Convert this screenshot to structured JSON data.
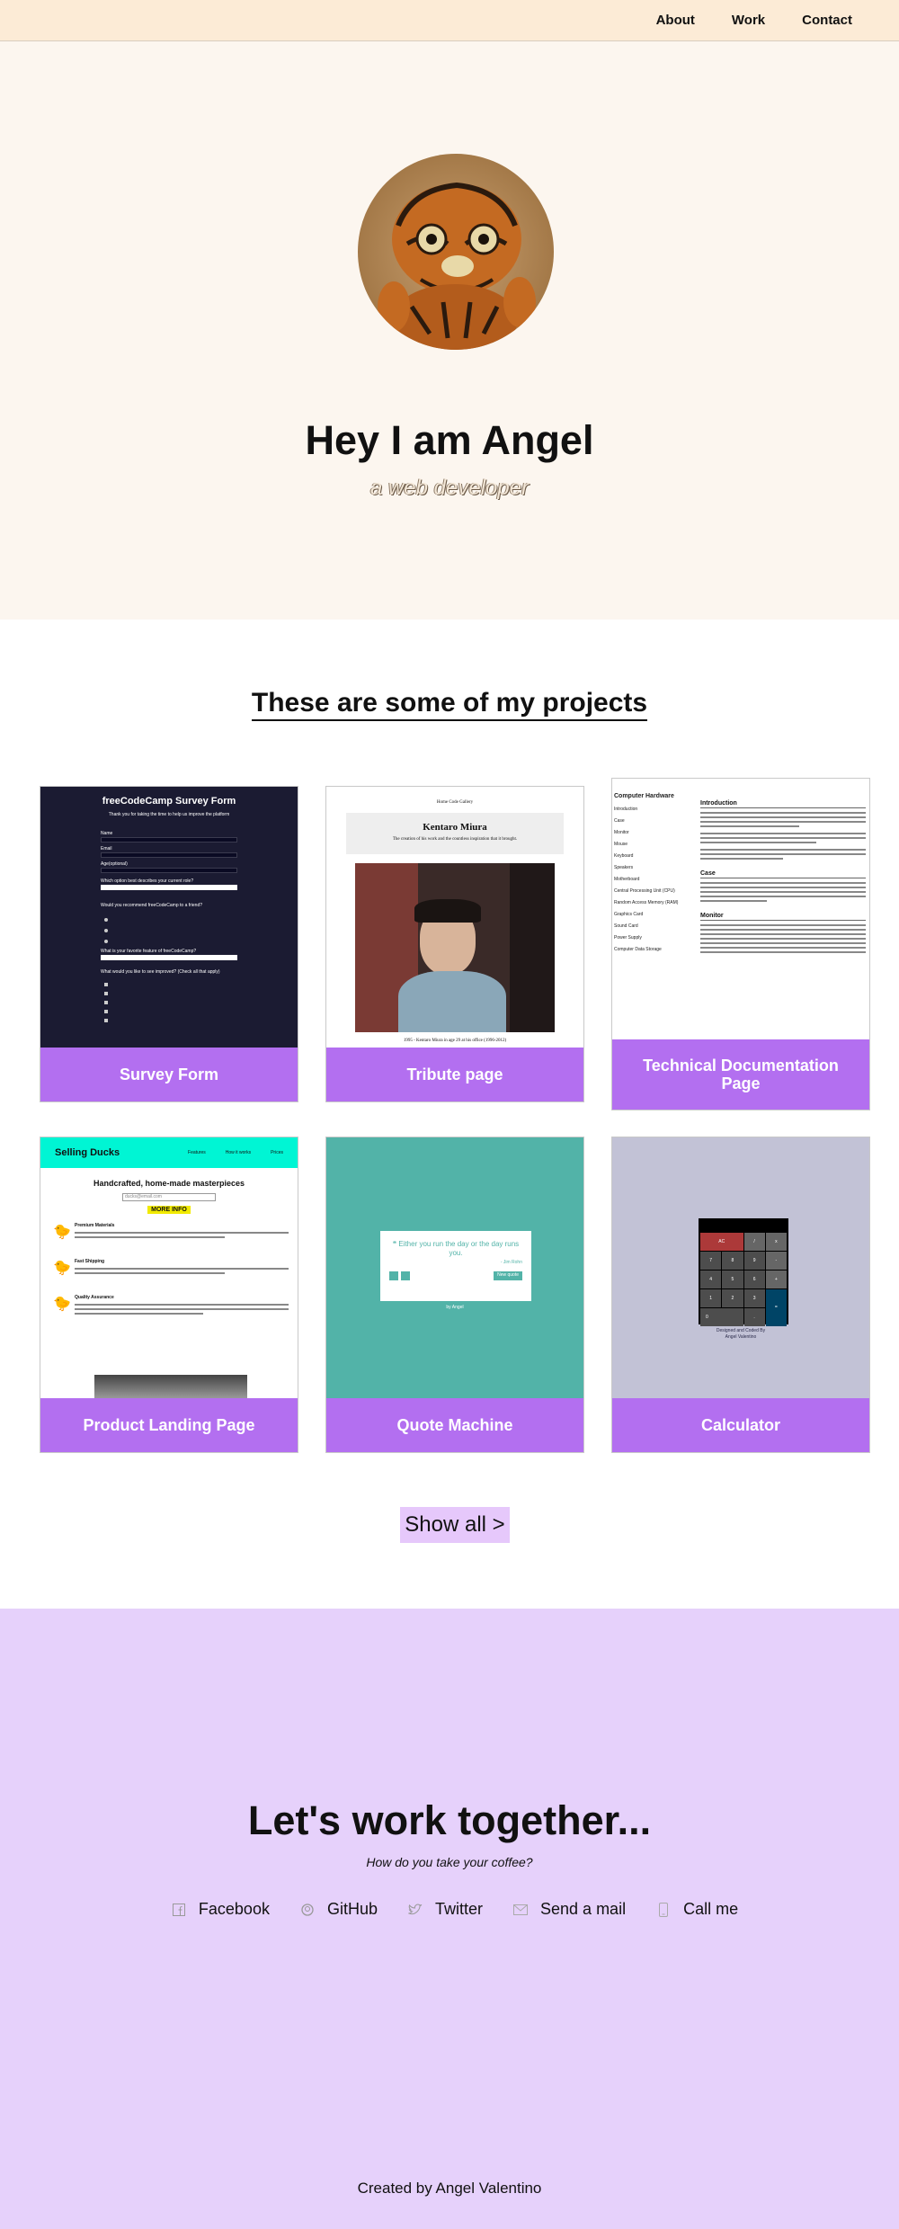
{
  "nav": {
    "links": [
      "About",
      "Work",
      "Contact"
    ]
  },
  "hero": {
    "title": "Hey I am Angel",
    "subtitle": "a web developer"
  },
  "projects": {
    "heading": "These are some of my projects",
    "items": [
      {
        "label": "Survey Form"
      },
      {
        "label": "Tribute page"
      },
      {
        "label": "Technical Documentation Page"
      },
      {
        "label": "Product Landing Page"
      },
      {
        "label": "Quote Machine"
      },
      {
        "label": "Calculator"
      }
    ],
    "show_all": "Show all >"
  },
  "thumbs": {
    "survey": {
      "title": "freeCodeCamp Survey Form",
      "subtitle": "Thank you for taking the time to help us improve the platform",
      "fields": [
        "Name",
        "Email",
        "Age(optional)",
        "Which option best describes your current role?",
        "Would you recommend freeCodeCamp to a friend?",
        "What is your favorite feature of freeCodeCamp?",
        "What would you like to see improved? (Check all that apply)"
      ]
    },
    "tribute": {
      "nav": "Home   Code   Gallery",
      "name": "Kentaro Miura",
      "caption": "The creation of his work and the countless inspiration that it brought.",
      "footer": "1995 - Kentaro Miura in age 29 at his office (1996-2012)"
    },
    "docs": {
      "sidebar_title": "Computer Hardware",
      "sidebar": [
        "Introduction",
        "Case",
        "Monitor",
        "Mouse",
        "Keyboard",
        "Speakers",
        "Motherboard",
        "Central Processing Unit (CPU)",
        "Random Access Memory (RAM)",
        "Graphics Card",
        "Sound Card",
        "Power Supply",
        "Computer Data Storage"
      ],
      "sections": [
        "Introduction",
        "Case",
        "Monitor"
      ]
    },
    "landing": {
      "brand": "Selling Ducks",
      "menu": [
        "Features",
        "How it works",
        "Prices"
      ],
      "headline": "Handcrafted, home-made masterpieces",
      "email_placeholder": "ducks@email.com",
      "cta": "MORE INFO",
      "features": [
        "Premium Materials",
        "Fast Shipping",
        "Quality Assurance"
      ]
    },
    "quote": {
      "text": "Either you run the day or the day runs you.",
      "author": "- Jim Rohn",
      "new_quote": "New quote",
      "by": "by Angel"
    },
    "calc": {
      "credit": "Designed and Coded By",
      "author": "Angel Valentino",
      "keys": [
        "AC",
        "/",
        "x",
        "7",
        "8",
        "9",
        "-",
        "4",
        "5",
        "6",
        "+",
        "1",
        "2",
        "3",
        "=",
        "0",
        "."
      ]
    }
  },
  "contact": {
    "heading": "Let's work together...",
    "tagline": "How do you take your coffee?",
    "links": [
      {
        "icon": "facebook-icon",
        "label": "Facebook"
      },
      {
        "icon": "github-icon",
        "label": "GitHub"
      },
      {
        "icon": "twitter-icon",
        "label": "Twitter"
      },
      {
        "icon": "mail-icon",
        "label": "Send a mail"
      },
      {
        "icon": "phone-icon",
        "label": "Call me"
      }
    ]
  },
  "footer": {
    "text": "Created by Angel Valentino"
  },
  "colors": {
    "nav_bg": "#fcebd6",
    "hero_bg": "#fcf6ef",
    "card_label": "#b36ff0",
    "contact_bg": "#e6d1fb",
    "show_all_bg": "#e6c8fb"
  }
}
